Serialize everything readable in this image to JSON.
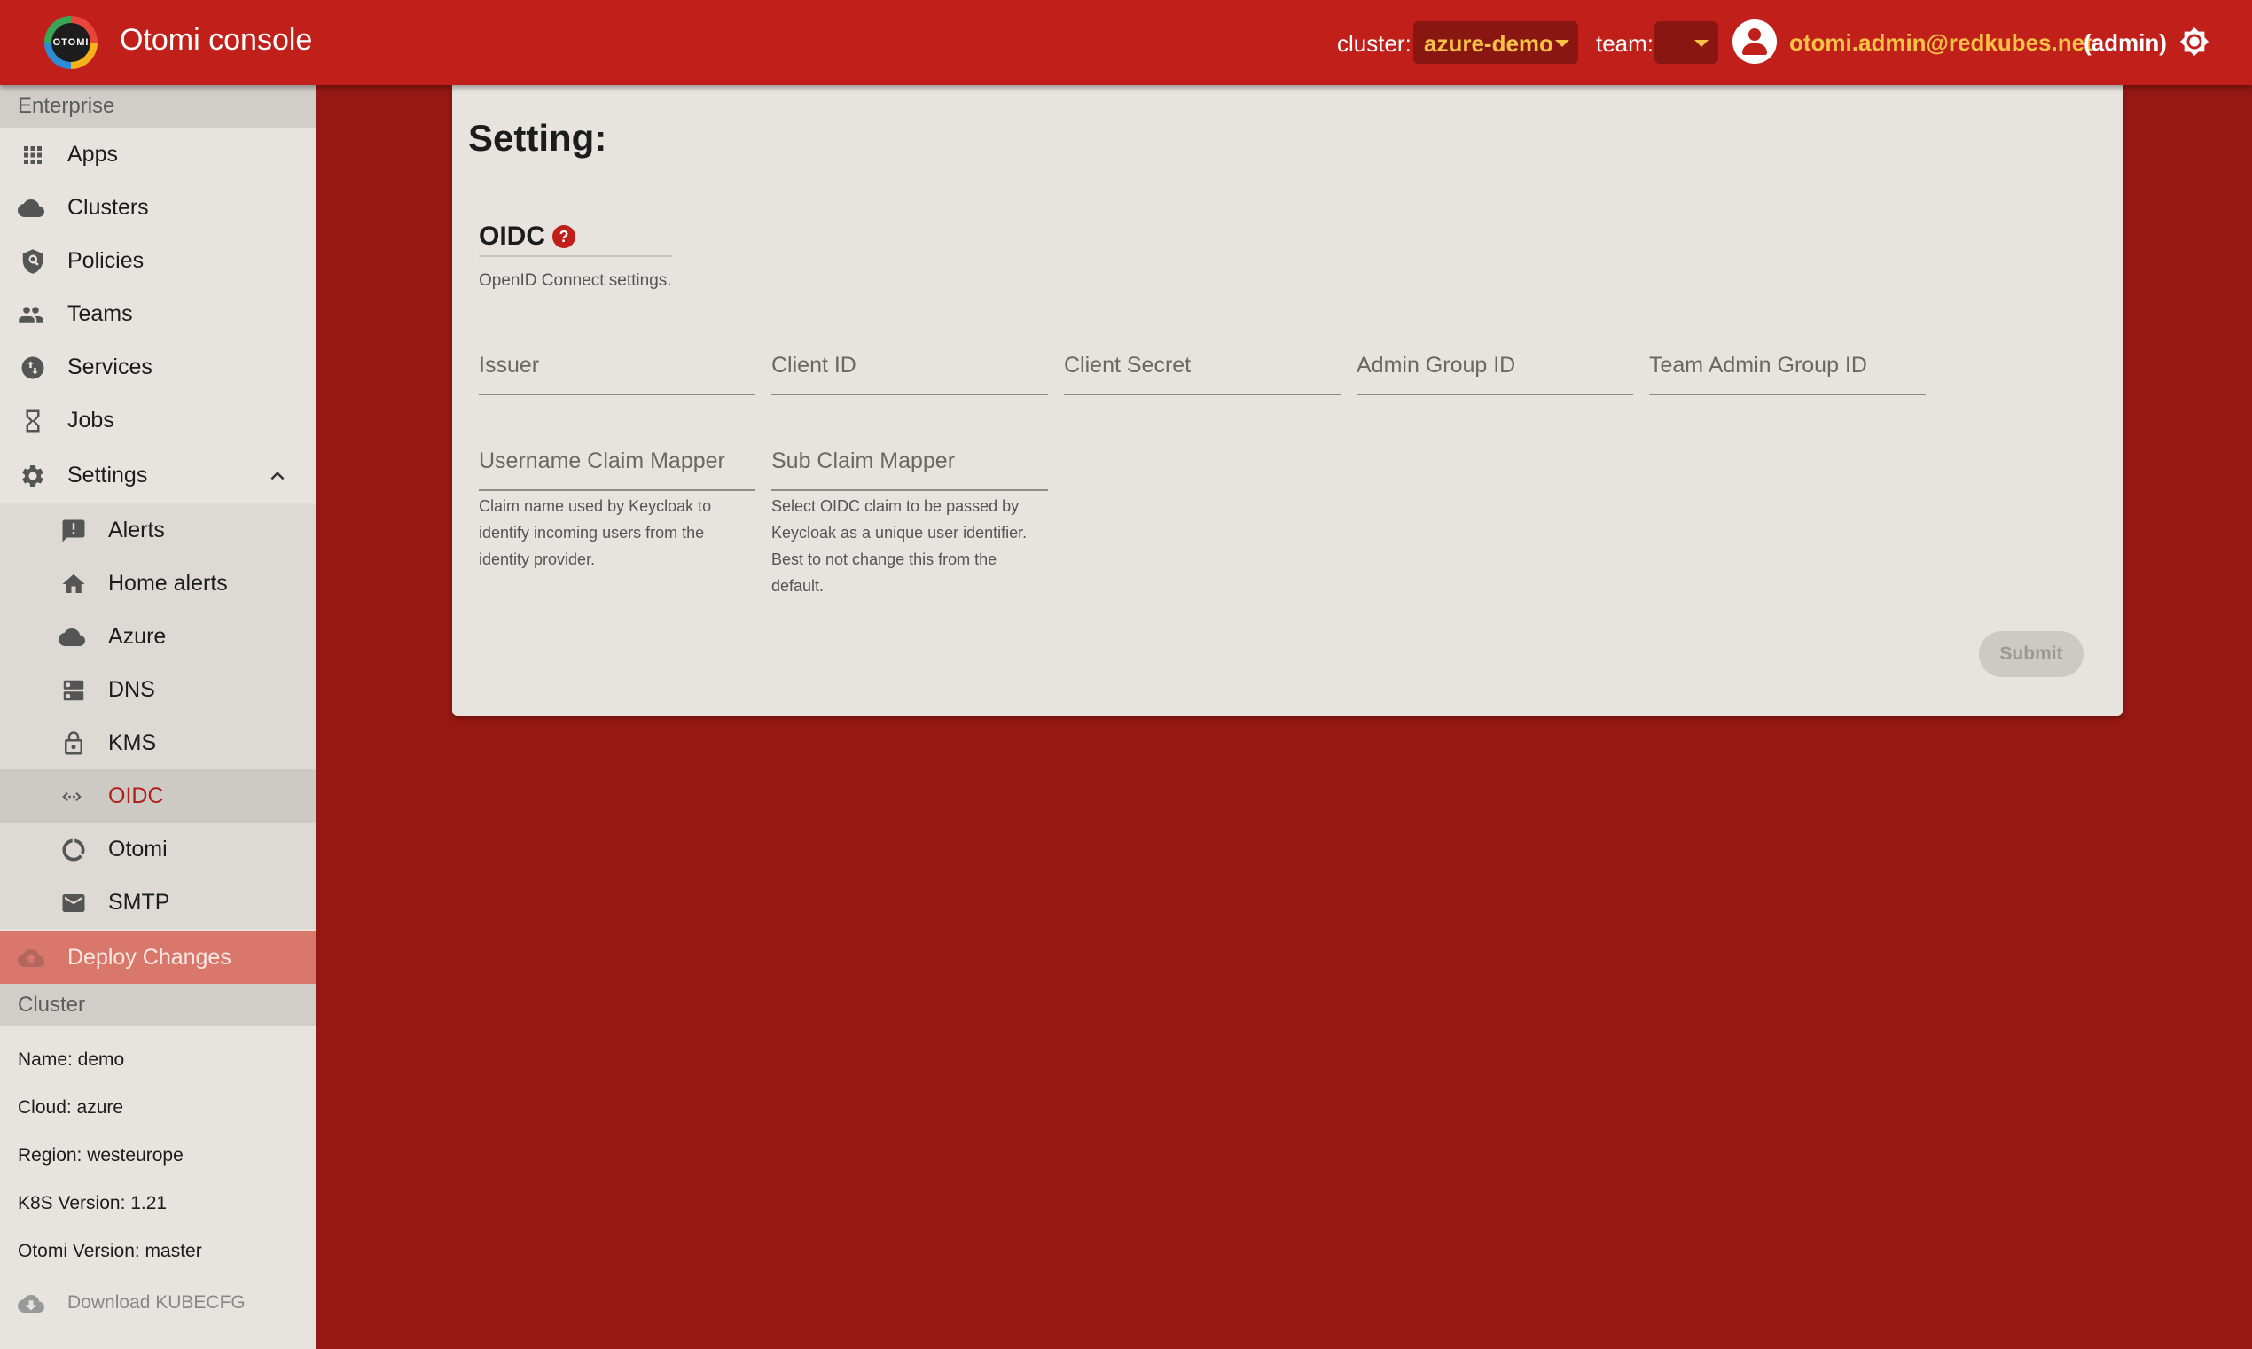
{
  "header": {
    "logo_text": "OTOMI",
    "app_title": "Otomi console",
    "cluster_label": "cluster:",
    "cluster_value": "azure-demo",
    "team_label": "team:",
    "team_value": "",
    "user_email": "otomi.admin@redkubes.net",
    "user_role": "(admin)",
    "accent_color": "#f7c246",
    "bar_color": "#c11f19"
  },
  "sidebar": {
    "section_enterprise": "Enterprise",
    "items": [
      {
        "label": "Apps",
        "icon": "apps-grid-icon"
      },
      {
        "label": "Clusters",
        "icon": "cloud-icon"
      },
      {
        "label": "Policies",
        "icon": "shield-search-icon"
      },
      {
        "label": "Teams",
        "icon": "people-icon"
      },
      {
        "label": "Services",
        "icon": "swap-vert-icon"
      },
      {
        "label": "Jobs",
        "icon": "hourglass-icon"
      },
      {
        "label": "Settings",
        "icon": "gear-icon"
      }
    ],
    "settings_items": [
      {
        "label": "Alerts",
        "icon": "alert-message-icon"
      },
      {
        "label": "Home alerts",
        "icon": "home-icon"
      },
      {
        "label": "Azure",
        "icon": "cloud-icon"
      },
      {
        "label": "DNS",
        "icon": "dns-icon"
      },
      {
        "label": "KMS",
        "icon": "lock-icon"
      },
      {
        "label": "OIDC",
        "icon": "code-arrows-icon"
      },
      {
        "label": "Otomi",
        "icon": "circle-notch-icon"
      },
      {
        "label": "SMTP",
        "icon": "mail-icon"
      }
    ],
    "active_item": "OIDC",
    "deploy_label": "Deploy Changes",
    "section_cluster": "Cluster",
    "cluster_info": {
      "name": "Name: demo",
      "cloud": "Cloud: azure",
      "region": "Region: westeurope",
      "k8s": "K8S Version: 1.21",
      "otomi": "Otomi Version: master"
    },
    "download_label": "Download KUBECFG"
  },
  "main": {
    "page_title": "Setting:",
    "section_title": "OIDC",
    "section_description": "OpenID Connect settings.",
    "fields": {
      "issuer": "Issuer",
      "client_id": "Client ID",
      "client_secret": "Client Secret",
      "admin_group_id": "Admin Group ID",
      "team_admin_group_id": "Team Admin Group ID",
      "username_claim_mapper": "Username Claim Mapper",
      "sub_claim_mapper": "Sub Claim Mapper"
    },
    "help": {
      "username_claim_mapper": "Claim name used by Keycloak to identify incoming users from the identity provider.",
      "sub_claim_mapper": "Select OIDC claim to be passed by Keycloak as a unique user identifier. Best to not change this from the default."
    },
    "submit_label": "Submit"
  }
}
